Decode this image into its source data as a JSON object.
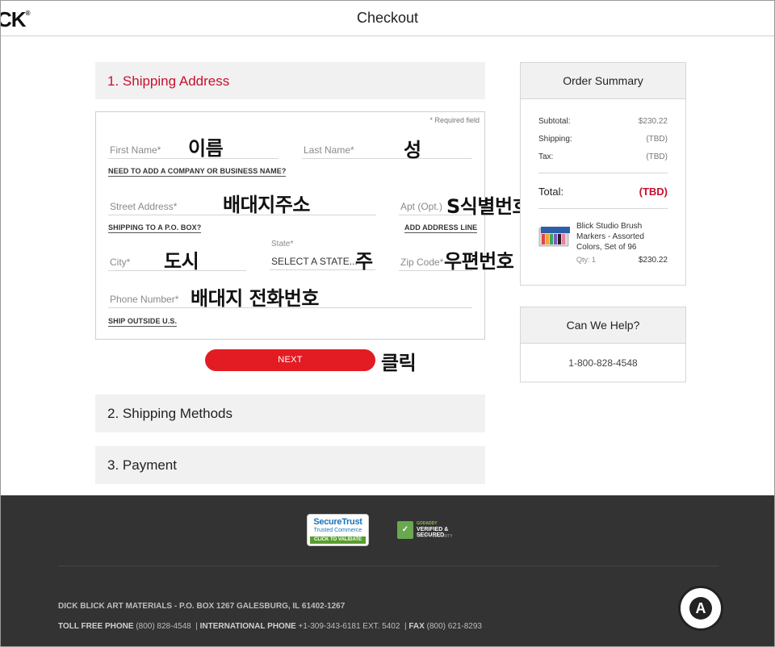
{
  "header": {
    "logo_text": "CK",
    "title": "Checkout"
  },
  "sections": {
    "shipping_address": "1. Shipping Address",
    "shipping_methods": "2. Shipping Methods",
    "payment": "3. Payment"
  },
  "form": {
    "required_note": "* Required field",
    "first_name_placeholder": "First Name*",
    "last_name_placeholder": "Last Name*",
    "company_link": "NEED TO ADD A COMPANY OR BUSINESS NAME?",
    "street_placeholder": "Street Address*",
    "apt_placeholder": "Apt (Opt.)",
    "po_box_link": "SHIPPING TO A P.O. BOX?",
    "add_line_link": "ADD ADDRESS LINE",
    "city_placeholder": "City*",
    "state_label": "State*",
    "state_value": "SELECT A STATE...",
    "zip_placeholder": "Zip Code*",
    "phone_placeholder": "Phone Number*",
    "ship_outside_link": "SHIP OUTSIDE U.S.",
    "next_button": "NEXT"
  },
  "annotations": {
    "first_name": "이름",
    "last_name": "성",
    "street": "배대지주소",
    "apt": "S식별번호",
    "city": "도시",
    "state": "주",
    "zip": "우편번호",
    "phone": "배대지  전화번호",
    "click": "클릭"
  },
  "order_summary": {
    "title": "Order Summary",
    "subtotal_label": "Subtotal:",
    "subtotal_value": "$230.22",
    "shipping_label": "Shipping:",
    "shipping_value": "(TBD)",
    "tax_label": "Tax:",
    "tax_value": "(TBD)",
    "total_label": "Total:",
    "total_value": "(TBD)",
    "product": {
      "name": "Blick Studio Brush Markers - Assorted Colors, Set of 96",
      "qty": "Qty: 1",
      "price": "$230.22"
    }
  },
  "help": {
    "title": "Can We Help?",
    "phone": "1-800-828-4548"
  },
  "footer": {
    "badge_securetrust": "SecureTrust",
    "badge_securetrust_sub": "Trusted Commerce",
    "badge_securetrust_cta": "CLICK TO VALIDATE",
    "badge_godaddy_top": "GODADDY",
    "badge_godaddy_main": "VERIFIED & SECURED",
    "badge_godaddy_sub": "VERIFY SECURITY",
    "address": "DICK BLICK ART MATERIALS - P.O. BOX 1267 GALESBURG, IL 61402-1267",
    "toll_free_label": "TOLL FREE PHONE",
    "toll_free_value": "(800) 828-4548",
    "intl_label": "INTERNATIONAL PHONE",
    "intl_value": "+1-309-343-6181 EXT. 5402",
    "fax_label": "FAX",
    "fax_value": "(800) 621-8293"
  },
  "colors": {
    "accent_red": "#c8102e",
    "button_red": "#e31b23",
    "footer_bg": "#333333"
  }
}
